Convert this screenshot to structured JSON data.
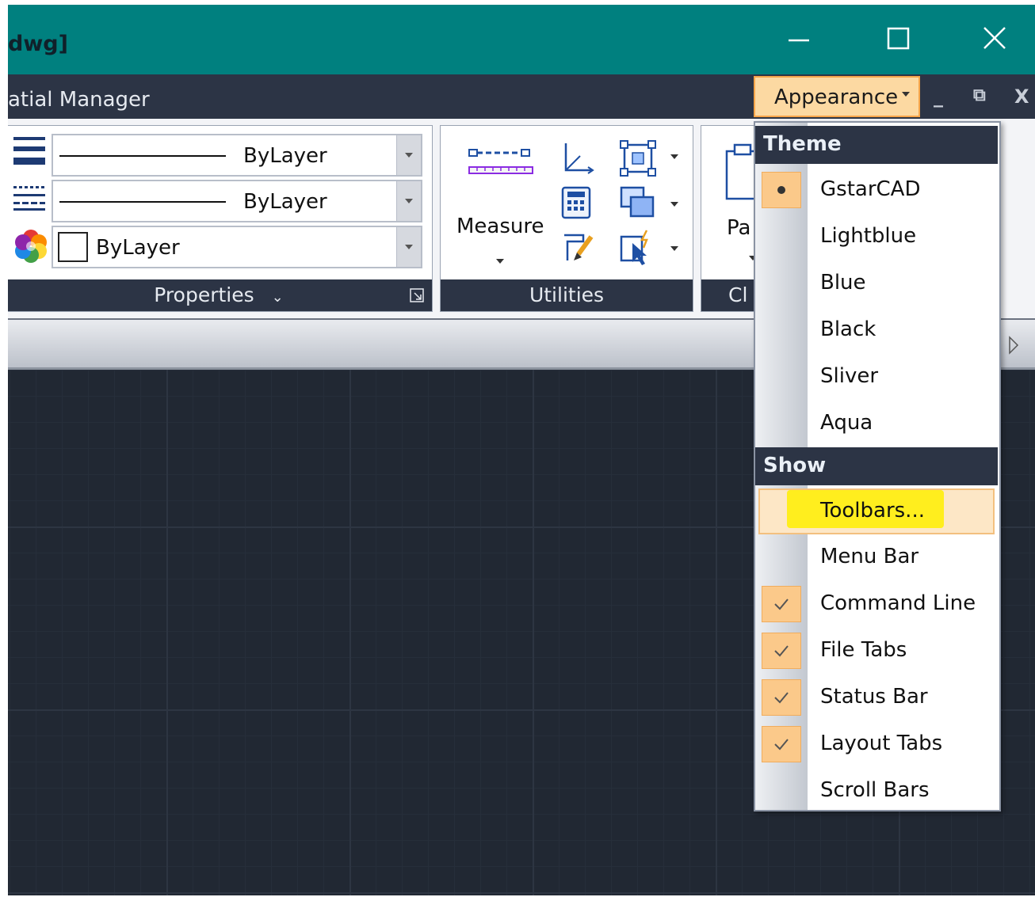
{
  "window": {
    "title": "dwg]",
    "controls": [
      "minimize-icon",
      "maximize-icon",
      "close-icon"
    ]
  },
  "menubar": {
    "items": [
      {
        "label": "atial Manager"
      }
    ],
    "appearance_label": "Appearance",
    "mdi_buttons": [
      "_",
      "⧉",
      "X"
    ]
  },
  "ribbon": {
    "properties": {
      "linetype_value": "ByLayer",
      "lineweight_value": "ByLayer",
      "color_value": "ByLayer",
      "footer": "Properties",
      "footer_caret": "⌄"
    },
    "utilities": {
      "measure_label": "Measure",
      "footer": "Utilities"
    },
    "clipboard": {
      "button_label": "Pa",
      "footer": "Cl"
    }
  },
  "appearance_menu": {
    "theme_header": "Theme",
    "themes": [
      {
        "label": "GstarCAD",
        "selected": true
      },
      {
        "label": "Lightblue",
        "selected": false
      },
      {
        "label": "Blue",
        "selected": false
      },
      {
        "label": "Black",
        "selected": false
      },
      {
        "label": "Sliver",
        "selected": false
      },
      {
        "label": "Aqua",
        "selected": false
      }
    ],
    "show_header": "Show",
    "show_items": [
      {
        "label": "Toolbars...",
        "checked": false,
        "highlighted": true
      },
      {
        "label": "Menu Bar",
        "checked": false
      },
      {
        "label": "Command Line",
        "checked": true
      },
      {
        "label": "File Tabs",
        "checked": true
      },
      {
        "label": "Status Bar",
        "checked": true
      },
      {
        "label": "Layout Tabs",
        "checked": true
      },
      {
        "label": "Scroll Bars",
        "checked": false
      }
    ]
  },
  "colors": {
    "titlebar": "#00807f",
    "dark_panel": "#2c3445",
    "menu_highlight": "#fde7c6",
    "check_box": "#fbc98a",
    "annotation_marker": "#ffee00",
    "canvas": "#212833"
  }
}
